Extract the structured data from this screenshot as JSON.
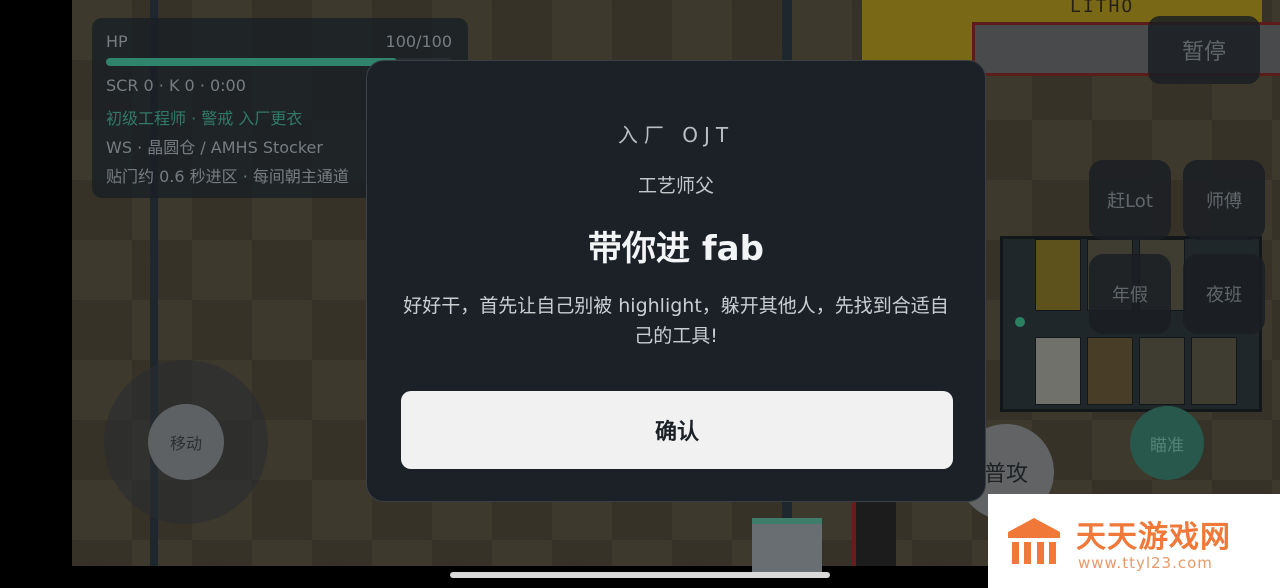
{
  "hud": {
    "hp_label": "HP",
    "hp_value": "100/100",
    "hp_fraction": 0.84,
    "stats": "SCR 0 · K 0 · 0:00",
    "role": "初级工程师 · 警戒 入厂更衣",
    "workstation": "WS · 晶圆仓 / AMHS Stocker",
    "hint": "贴门约 0.6 秒进区 · 每间朝主通道"
  },
  "world": {
    "bay_label": "LITHO"
  },
  "controls": {
    "pause": "暂停",
    "skills": [
      "赶Lot",
      "师傅",
      "年假",
      "夜班"
    ],
    "move": "移动",
    "attack": "普攻",
    "aim": "瞄准"
  },
  "dialog": {
    "kicker": "入厂 OJT",
    "speaker": "工艺师父",
    "title": "带你进 fab",
    "body": "好好干，首先让自己别被 highlight，躲开其他人，先找到合适自己的工具!",
    "confirm": "确认"
  },
  "watermark": {
    "name": "天天游戏网",
    "url": "www.ttyl23.com",
    "color": "#f07838"
  },
  "colors": {
    "accent": "#46c3a0",
    "dialog_bg": "#1b2127",
    "confirm_bg": "#f1f1f1"
  }
}
